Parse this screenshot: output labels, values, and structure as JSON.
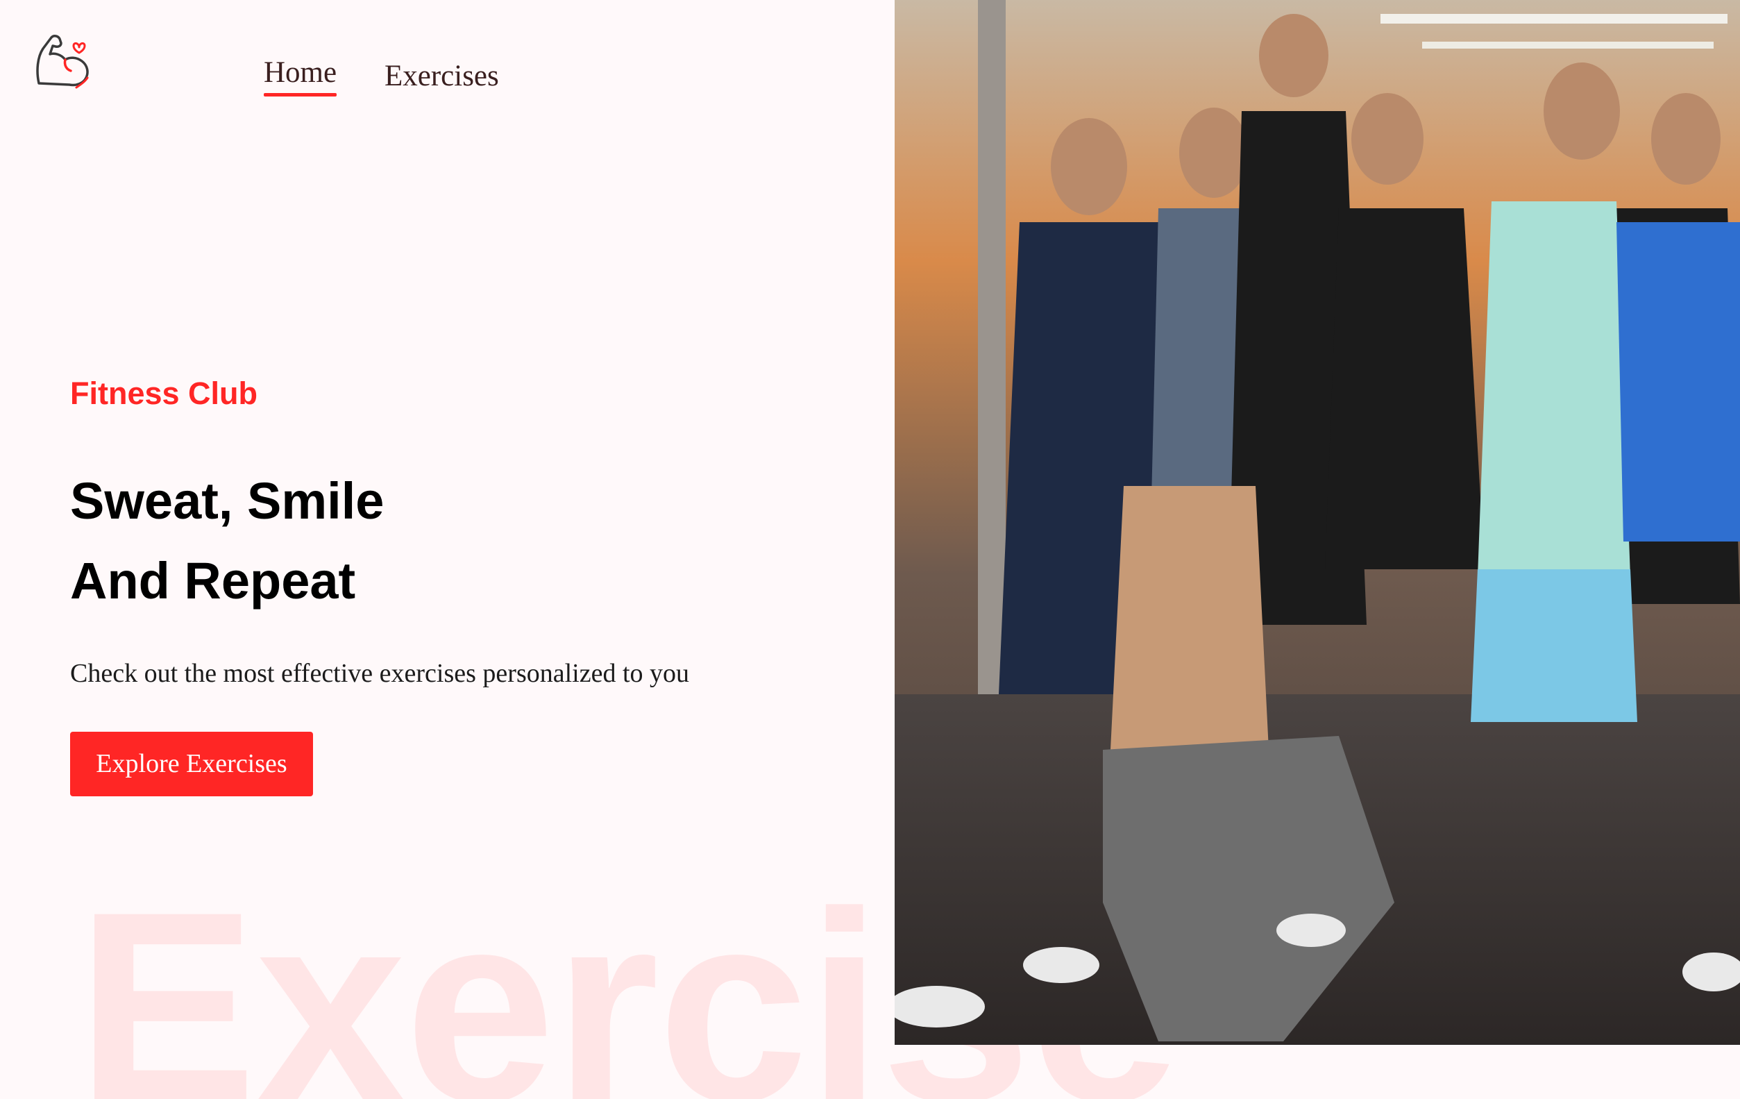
{
  "nav": {
    "home_label": "Home",
    "exercises_label": "Exercises"
  },
  "hero": {
    "tag": "Fitness Club",
    "title_line1": "Sweat, Smile",
    "title_line2": "And Repeat",
    "subtitle": "Check out the most effective exercises personalized to you",
    "button_label": "Explore Exercises"
  },
  "watermark": "Exercise",
  "icons": {
    "logo": "flexed-arm-heart-icon"
  },
  "colors": {
    "accent": "#ff2625",
    "background": "#fff9fa",
    "text": "#000000"
  }
}
